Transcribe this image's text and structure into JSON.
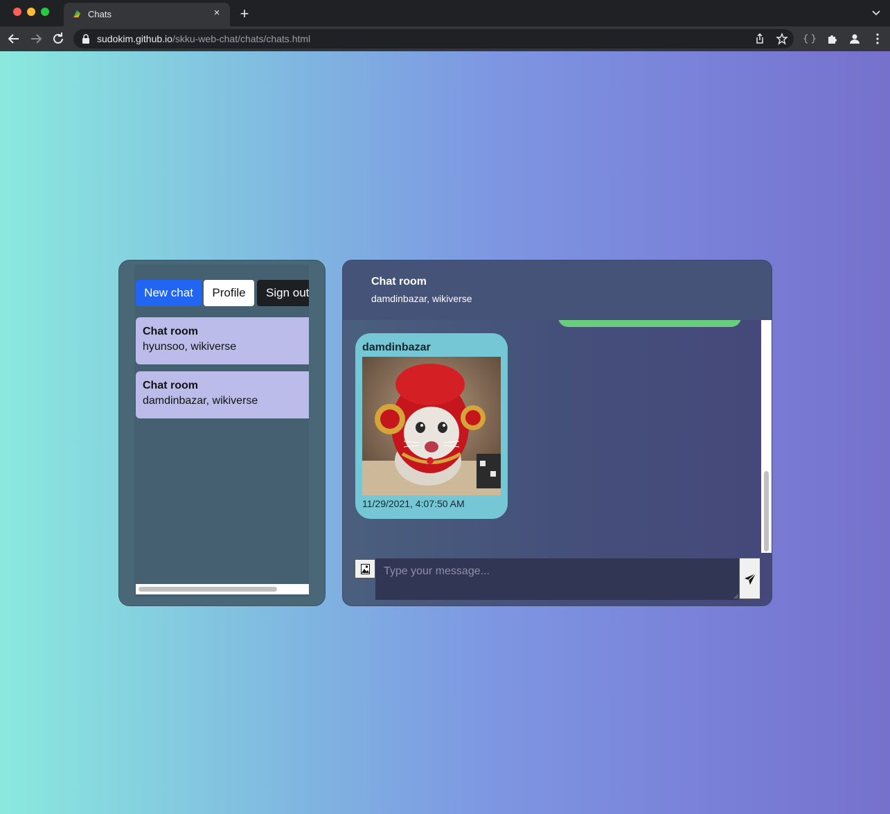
{
  "browser": {
    "tab_title": "Chats",
    "tab_close": "×",
    "new_tab": "+",
    "url_host": "sudokim.github.io",
    "url_path": "/skku-web-chat/chats/chats.html"
  },
  "sidebar": {
    "buttons": {
      "new_chat": "New chat",
      "profile": "Profile",
      "sign_out": "Sign out"
    },
    "rooms": [
      {
        "title": "Chat room",
        "members": "hyunsoo, wikiverse"
      },
      {
        "title": "Chat room",
        "members": "damdinbazar, wikiverse"
      }
    ]
  },
  "chat": {
    "title": "Chat room",
    "members": "damdinbazar, wikiverse",
    "messages": [
      {
        "author": "damdinbazar",
        "timestamp": "11/29/2021, 4:07:50 AM",
        "image_alt": "cat-in-red-hat-photo"
      }
    ],
    "input_placeholder": "Type your message..."
  },
  "colors": {
    "primary_button": "#2166f3",
    "room_card": "#bcbcea",
    "incoming_bubble": "#76c7d6",
    "outgoing_bubble": "#69cd7e"
  }
}
